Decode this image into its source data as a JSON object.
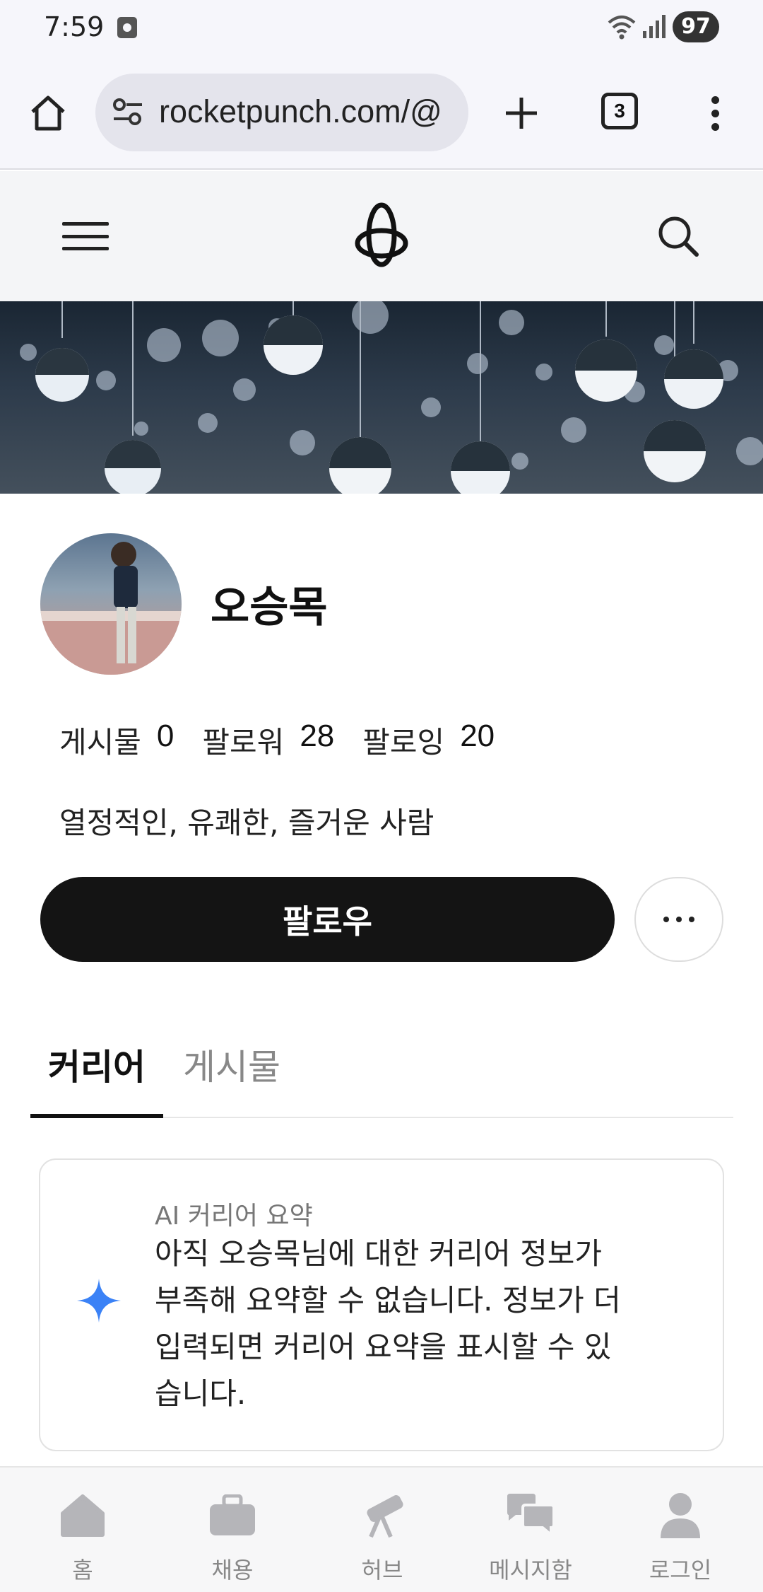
{
  "status_bar": {
    "time": "7:59",
    "battery": "97"
  },
  "browser": {
    "url": "rocketpunch.com/@",
    "tab_count": "3"
  },
  "profile": {
    "name": "오승목",
    "stats": [
      {
        "label": "게시물",
        "value": "0"
      },
      {
        "label": "팔로워",
        "value": "28"
      },
      {
        "label": "팔로잉",
        "value": "20"
      }
    ],
    "bio": "열정적인, 유쾌한, 즐거운 사람",
    "follow_label": "팔로우"
  },
  "tabs": {
    "career": "커리어",
    "posts": "게시물"
  },
  "ai_summary": {
    "label": "AI 커리어 요약",
    "text": "아직 오승목님에 대한 커리어 정보가 부족해 요약할 수 없습니다. 정보가 더 입력되면 커리어 요약을 표시할 수 있습니다."
  },
  "bottom_nav": [
    {
      "label": "홈",
      "icon": "home-icon"
    },
    {
      "label": "채용",
      "icon": "briefcase-icon"
    },
    {
      "label": "허브",
      "icon": "telescope-icon"
    },
    {
      "label": "메시지함",
      "icon": "chat-icon"
    },
    {
      "label": "로그인",
      "icon": "person-icon"
    }
  ],
  "colors": {
    "primary_button": "#141414",
    "accent_sparkle": "#3b82f6",
    "muted_text": "#888888"
  }
}
